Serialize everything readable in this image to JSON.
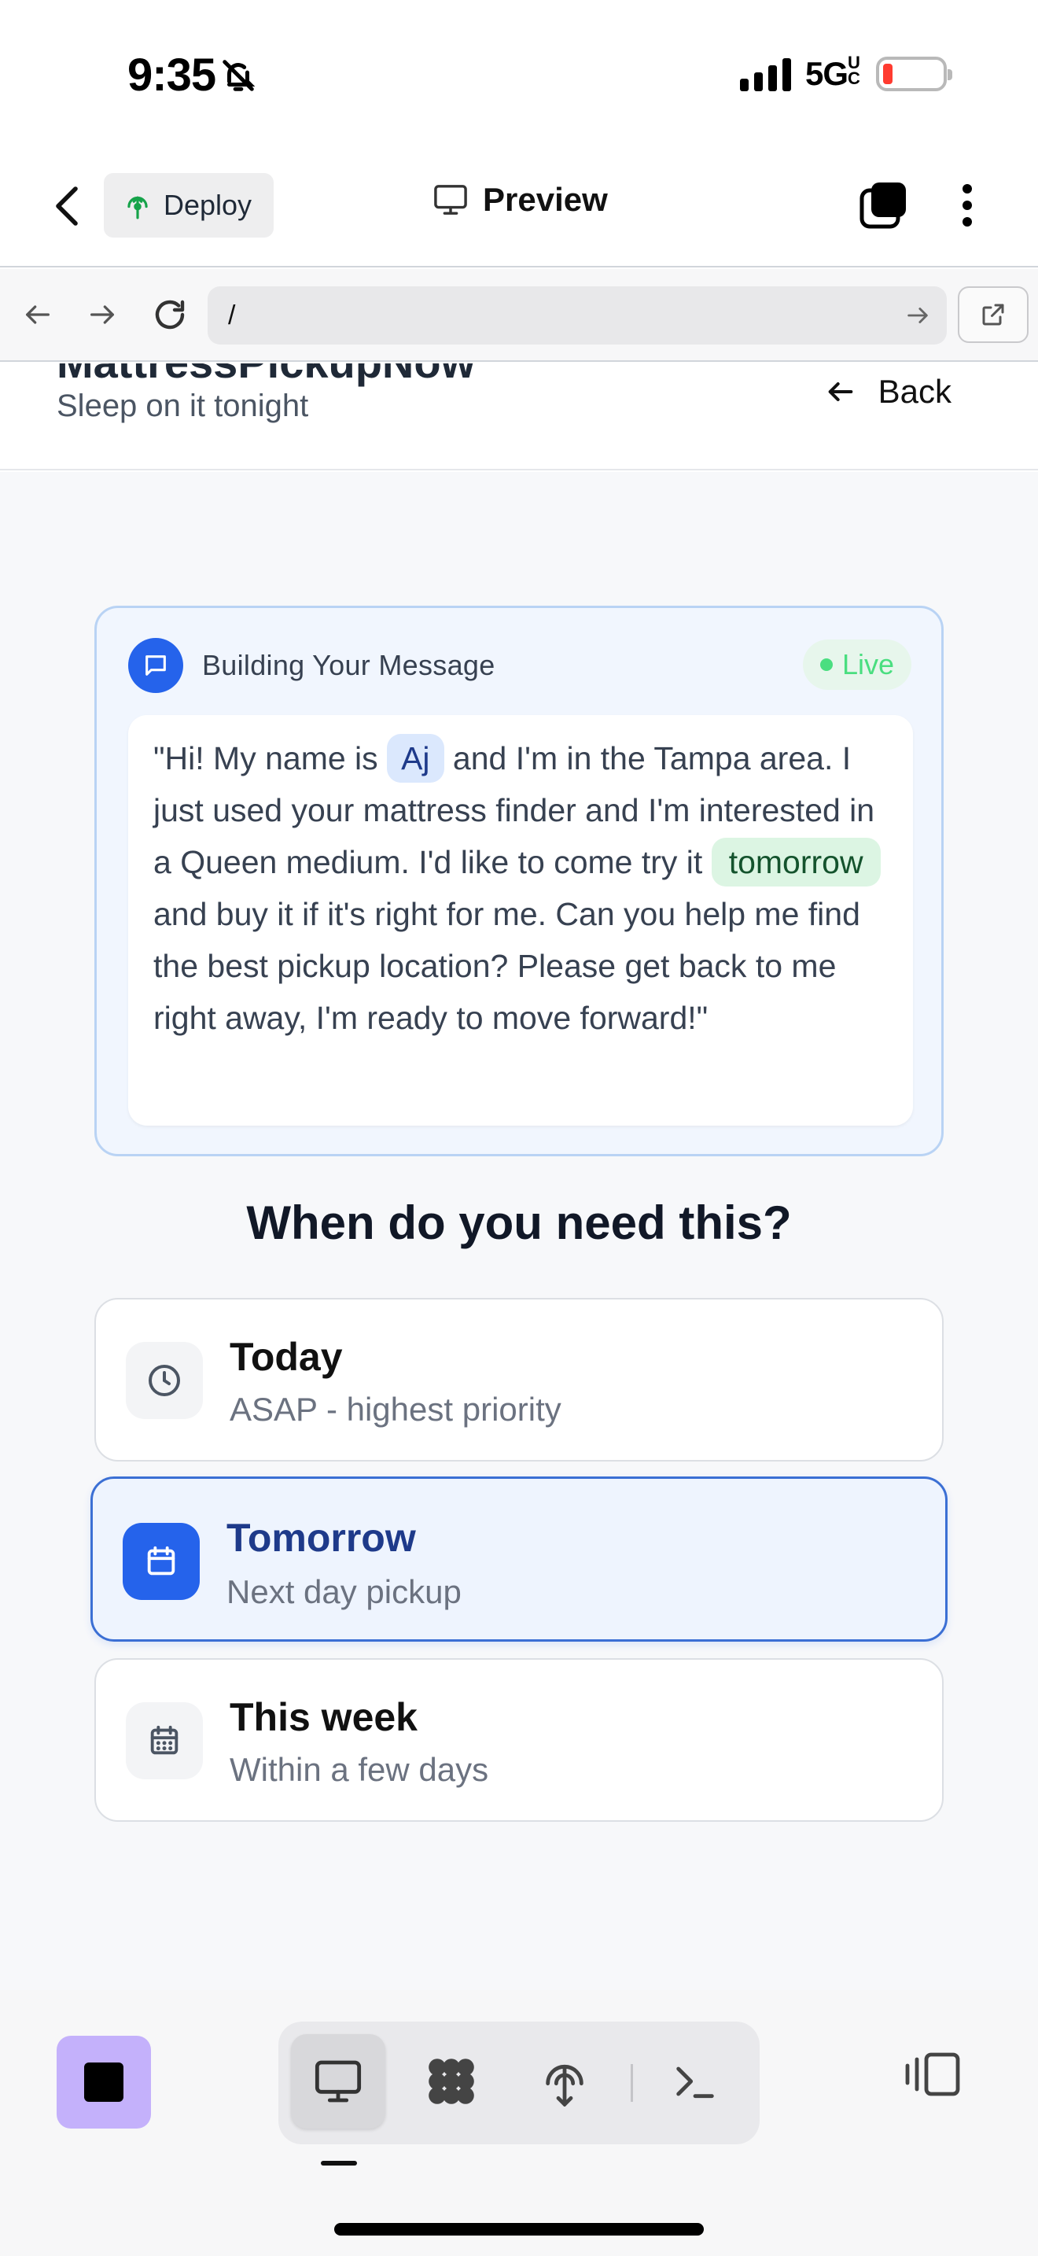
{
  "status_bar": {
    "time": "9:35",
    "network": "5G",
    "network_sup": "UC"
  },
  "app_bar": {
    "deploy_label": "Deploy",
    "preview_label": "Preview"
  },
  "url_bar": {
    "url": "/"
  },
  "page_header": {
    "title": "MattressPickupNow",
    "subtitle": "Sleep on it tonight",
    "back_label": "Back"
  },
  "message_card": {
    "title": "Building Your Message",
    "status": "Live",
    "text_1": "\"Hi! My name is ",
    "name": "Aj",
    "text_2": " and I'm in the Tampa area. I just used your mattress finder and I'm interested in a Queen medium. I'd like to come try it ",
    "when": "tomorrow",
    "text_3": " and buy it if it's right for me. Can you help me find the best pickup location? Please get back to me right away, I'm ready to move forward!\""
  },
  "question": "When do you need this?",
  "options": [
    {
      "title": "Today",
      "subtitle": "ASAP - highest priority",
      "icon": "clock-icon",
      "selected": false
    },
    {
      "title": "Tomorrow",
      "subtitle": "Next day pickup",
      "icon": "calendar-icon",
      "selected": true
    },
    {
      "title": "This week",
      "subtitle": "Within a few days",
      "icon": "calendar-days-icon",
      "selected": false
    }
  ],
  "bottom_toolbar": {
    "active_view": "preview",
    "items": [
      "monitor-icon",
      "apps-icon",
      "deploy-icon",
      "terminal-icon"
    ]
  },
  "colors": {
    "accent": "#2563eb",
    "live": "#4ade80",
    "stop_button": "#c4b1fb"
  }
}
